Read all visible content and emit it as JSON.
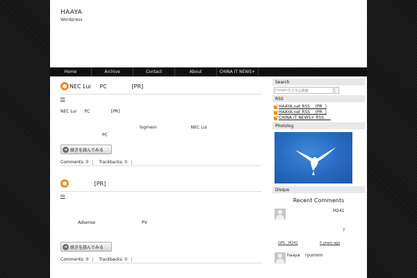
{
  "header": {
    "title": "HAAYA",
    "description": "Wordpress"
  },
  "nav": {
    "items": [
      "Home",
      "Archive",
      "Contact",
      "About",
      "CHINA IT NEWS+"
    ]
  },
  "posts": [
    {
      "title": "NEC Lui     PC              [PR]",
      "category": "PR",
      "lines": [
        "NEC Lui      PC                [PR]",
        "logmein                          NEC Lui",
        "PC"
      ],
      "read_more": "続きを読んでみる",
      "comments": "Comments: 0",
      "trackbacks": "Trackbacks: 0"
    },
    {
      "title": "              [PR]",
      "category": "PR",
      "lines": [
        "Adsense                                   PV"
      ],
      "read_more": "続きを読んでみる",
      "comments": "Comments: 0",
      "trackbacks": "Trackbacks: 0"
    }
  ],
  "sidebar": {
    "search": {
      "heading": "Search",
      "placeholder_brand": "Google",
      "placeholder_text": "カスタム検索"
    },
    "rss": {
      "heading": "RSS",
      "links": [
        "HAAYA.net RSS    (PR  )",
        "HAAYA.net RSS    (PR  )",
        "CHINA IT NEWS+ RSS     "
      ]
    },
    "photolog": {
      "heading": "Photolog"
    },
    "disqus": {
      "heading": "Disqus",
      "recent_title": "Recent Comments",
      "comments": [
        {
          "author": "M241",
          "extra": "?",
          "meta_author": "GPS   M241",
          "meta_time": "5 years ago"
        },
        {
          "author": "haaya    ryumom"
        }
      ]
    }
  }
}
